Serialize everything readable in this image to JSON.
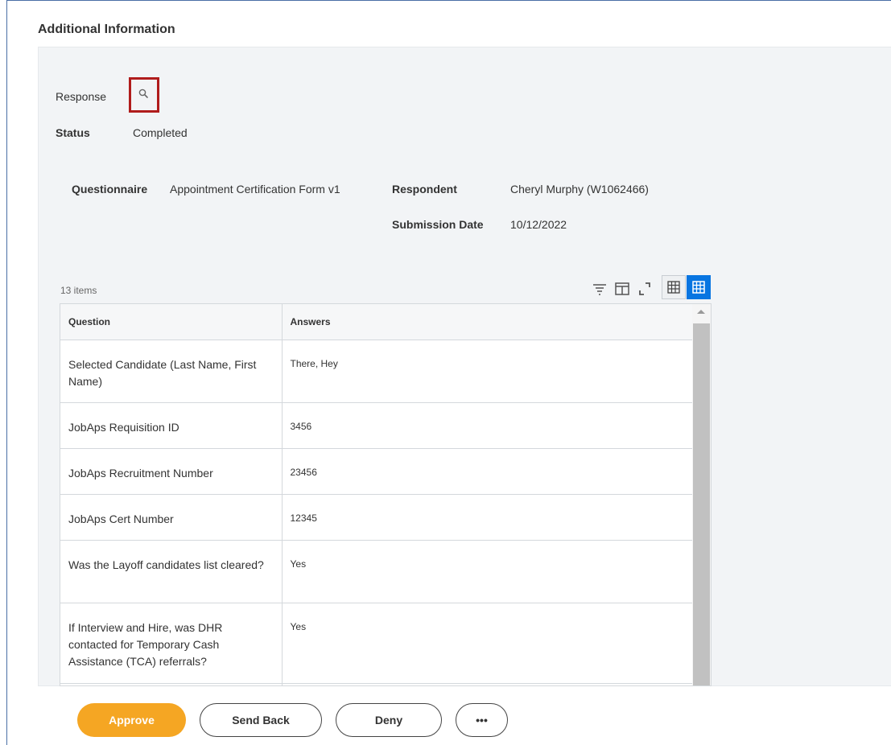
{
  "section": {
    "title": "Additional Information"
  },
  "response": {
    "label": "Response",
    "icon": "search-icon"
  },
  "status": {
    "label": "Status",
    "value": "Completed"
  },
  "details": {
    "questionnaire_label": "Questionnaire",
    "questionnaire_value": "Appointment Certification Form v1",
    "respondent_label": "Respondent",
    "respondent_value": "Cheryl Murphy (W1062466)",
    "submission_label": "Submission Date",
    "submission_value": "10/12/2022"
  },
  "grid": {
    "count": "13 items",
    "columns": [
      "Question",
      "Answers"
    ],
    "rows": [
      {
        "question": "Selected Candidate (Last Name, First Name)",
        "answer": "There, Hey"
      },
      {
        "question": "JobAps Requisition ID",
        "answer": "3456"
      },
      {
        "question": "JobAps Recruitment Number",
        "answer": "23456"
      },
      {
        "question": "JobAps Cert Number",
        "answer": "12345"
      },
      {
        "question": "Was the Layoff candidates list cleared?",
        "answer": "Yes"
      },
      {
        "question": "If Interview and Hire, was DHR contacted for Temporary Cash Assistance (TCA) referrals?",
        "answer": "Yes"
      }
    ],
    "toolbar_icons": [
      "filter-icon",
      "columns-icon",
      "expand-icon",
      "table-view-icon",
      "grid-view-icon"
    ]
  },
  "actions": {
    "approve": "Approve",
    "send_back": "Send Back",
    "deny": "Deny",
    "more": "•••"
  },
  "colors": {
    "accent": "#f5a623",
    "active_view": "#0875e1",
    "highlight": "#b01c1c"
  }
}
